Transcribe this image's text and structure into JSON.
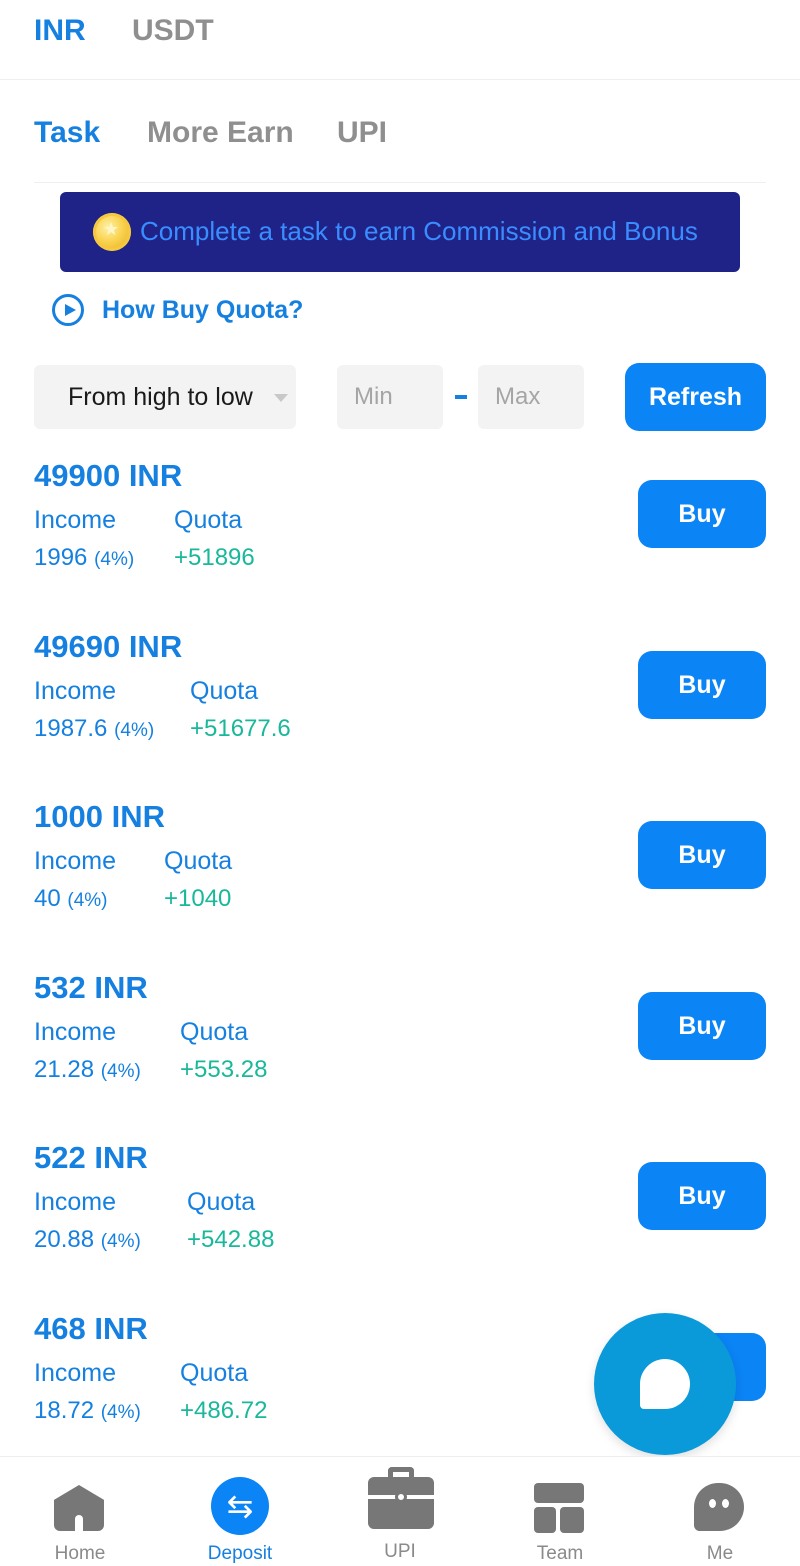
{
  "currency_tabs": [
    {
      "label": "INR",
      "active": true
    },
    {
      "label": "USDT",
      "active": false
    }
  ],
  "task_tabs": [
    {
      "label": "Task",
      "active": true
    },
    {
      "label": "More Earn",
      "active": false
    },
    {
      "label": "UPI",
      "active": false
    }
  ],
  "banner": {
    "text": "Complete a task to earn Commission and Bonus",
    "icon": "coin-icon"
  },
  "how_buy": {
    "text": "How Buy Quota?",
    "icon": "play-circle-icon"
  },
  "filter": {
    "sort_value": "From high to low",
    "min_placeholder": "Min",
    "max_placeholder": "Max",
    "dash": "-",
    "refresh_label": "Refresh"
  },
  "offers": [
    {
      "amount": "49900 INR",
      "income_label": "Income",
      "income": "1996",
      "pct": "(4%)",
      "quota_label": "Quota",
      "quota": "+51896",
      "buy_label": "Buy"
    },
    {
      "amount": "49690 INR",
      "income_label": "Income",
      "income": "1987.6",
      "pct": "(4%)",
      "quota_label": "Quota",
      "quota": "+51677.6",
      "buy_label": "Buy"
    },
    {
      "amount": "1000 INR",
      "income_label": "Income",
      "income": "40",
      "pct": "(4%)",
      "quota_label": "Quota",
      "quota": "+1040",
      "buy_label": "Buy"
    },
    {
      "amount": "532 INR",
      "income_label": "Income",
      "income": "21.28",
      "pct": "(4%)",
      "quota_label": "Quota",
      "quota": "+553.28",
      "buy_label": "Buy"
    },
    {
      "amount": "522 INR",
      "income_label": "Income",
      "income": "20.88",
      "pct": "(4%)",
      "quota_label": "Quota",
      "quota": "+542.88",
      "buy_label": "Buy"
    },
    {
      "amount": "468 INR",
      "income_label": "Income",
      "income": "18.72",
      "pct": "(4%)",
      "quota_label": "Quota",
      "quota": "+486.72",
      "buy_label": "Buy"
    }
  ],
  "bottom_nav": [
    {
      "label": "Home",
      "icon": "home-icon",
      "active": false
    },
    {
      "label": "Deposit",
      "icon": "deposit-icon",
      "active": true
    },
    {
      "label": "UPI",
      "icon": "briefcase-icon",
      "active": false
    },
    {
      "label": "Team",
      "icon": "team-grid-icon",
      "active": false
    },
    {
      "label": "Me",
      "icon": "profile-icon",
      "active": false
    }
  ],
  "colors": {
    "accent": "#1580e0",
    "button": "#0b84f6",
    "quota_green": "#19b89a",
    "banner_bg": "#1f2388",
    "chat_fab": "#0a9ad9"
  }
}
